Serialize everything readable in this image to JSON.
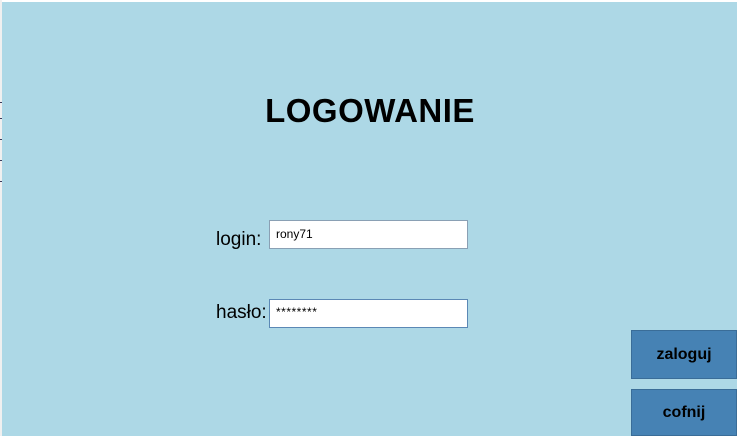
{
  "screen": {
    "title": "LOGOWANIE"
  },
  "form": {
    "login_label": "login:",
    "login_value": "rony71",
    "password_label": "hasło:",
    "password_value": "********"
  },
  "buttons": {
    "login_button": "zaloguj",
    "back_button": "cofnij"
  },
  "colors": {
    "background": "#add8e6",
    "button": "#4682b4"
  }
}
